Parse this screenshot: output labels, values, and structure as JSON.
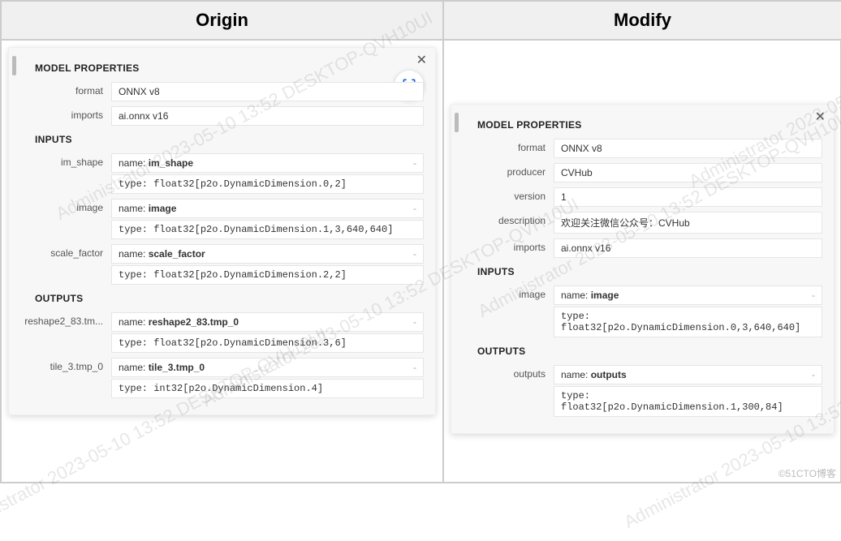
{
  "headers": {
    "origin": "Origin",
    "modify": "Modify"
  },
  "origin": {
    "title": "MODEL PROPERTIES",
    "props": {
      "format_lbl": "format",
      "format": "ONNX v8",
      "imports_lbl": "imports",
      "imports": "ai.onnx v16"
    },
    "inputs_title": "INPUTS",
    "inputs": {
      "im_shape_lbl": "im_shape",
      "im_shape_name": "name: ",
      "im_shape_name_b": "im_shape",
      "im_shape_type": "type: float32[p2o.DynamicDimension.0,2]",
      "image_lbl": "image",
      "image_name": "name: ",
      "image_name_b": "image",
      "image_type": "type: float32[p2o.DynamicDimension.1,3,640,640]",
      "scale_lbl": "scale_factor",
      "scale_name": "name: ",
      "scale_name_b": "scale_factor",
      "scale_type": "type: float32[p2o.DynamicDimension.2,2]"
    },
    "outputs_title": "OUTPUTS",
    "outputs": {
      "r_lbl": "reshape2_83.tm...",
      "r_name": "name: ",
      "r_name_b": "reshape2_83.tmp_0",
      "r_type": "type: float32[p2o.DynamicDimension.3,6]",
      "t_lbl": "tile_3.tmp_0",
      "t_name": "name: ",
      "t_name_b": "tile_3.tmp_0",
      "t_type": "type: int32[p2o.DynamicDimension.4]"
    }
  },
  "modify": {
    "title": "MODEL PROPERTIES",
    "props": {
      "format_lbl": "format",
      "format": "ONNX v8",
      "producer_lbl": "producer",
      "producer": "CVHub",
      "version_lbl": "version",
      "version": "1",
      "desc_lbl": "description",
      "desc": "欢迎关注微信公众号：CVHub",
      "imports_lbl": "imports",
      "imports": "ai.onnx v16"
    },
    "inputs_title": "INPUTS",
    "inputs": {
      "image_lbl": "image",
      "image_name": "name: ",
      "image_name_b": "image",
      "image_type": "type: float32[p2o.DynamicDimension.0,3,640,640]"
    },
    "outputs_title": "OUTPUTS",
    "outputs": {
      "out_lbl": "outputs",
      "out_name": "name: ",
      "out_name_b": "outputs",
      "out_type": "type: float32[p2o.DynamicDimension.1,300,84]"
    }
  },
  "watermark": "Administrator 2023-05-10 13:52 DESKTOP-QVH10UI",
  "credit": "©51CTO博客"
}
